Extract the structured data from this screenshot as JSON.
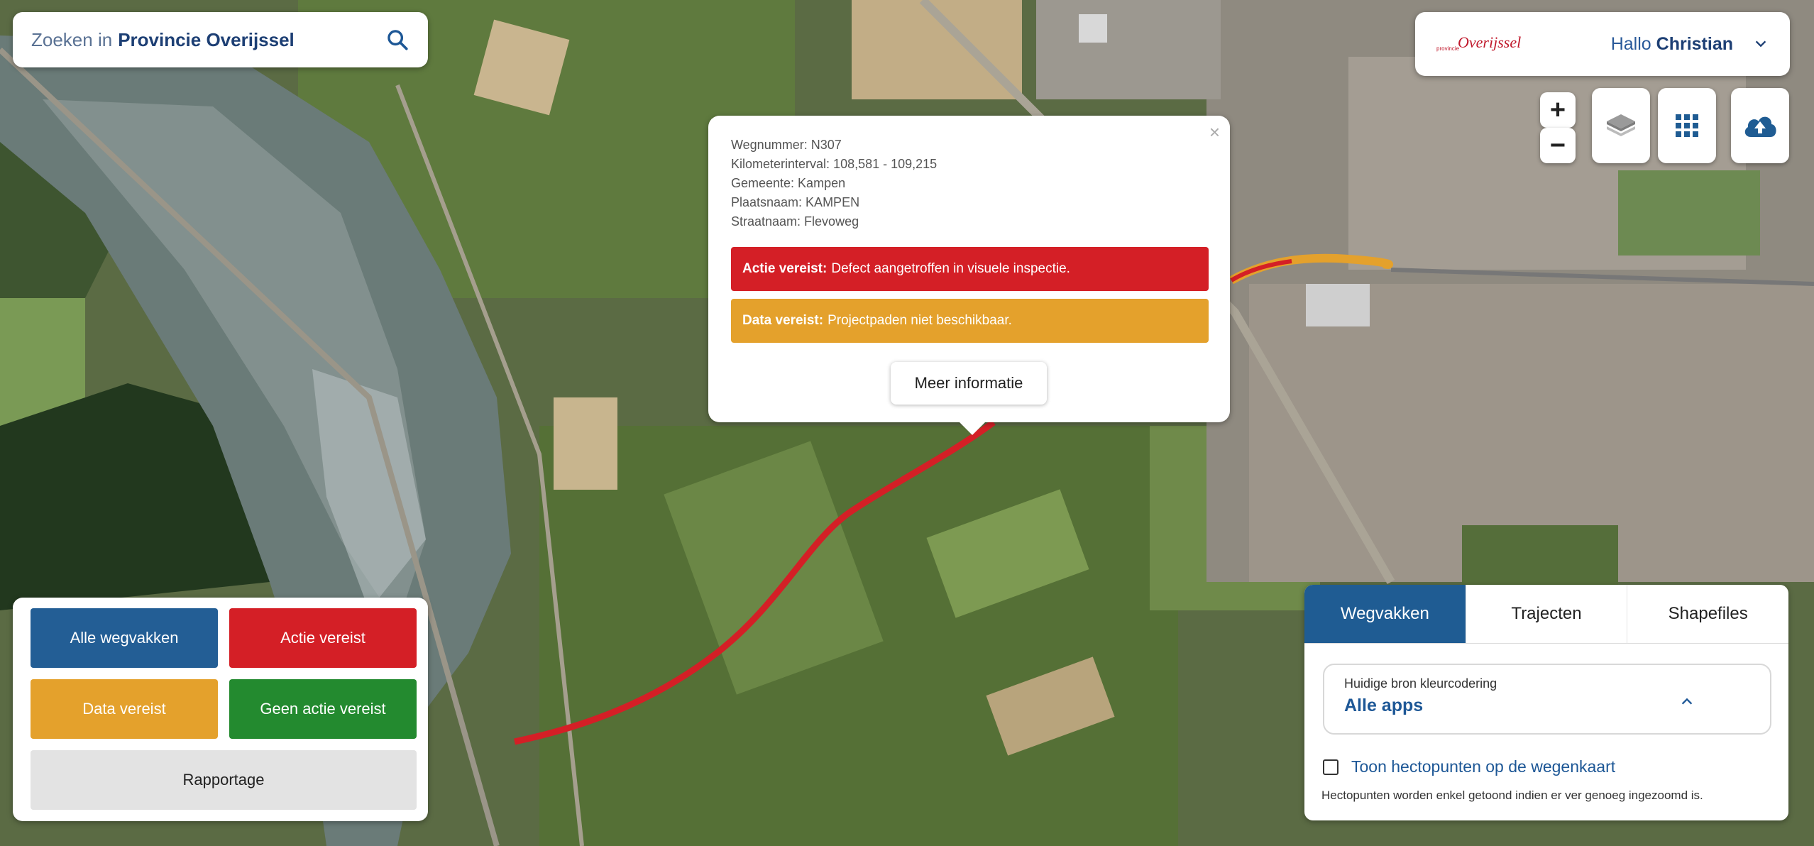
{
  "search": {
    "prefix": "Zoeken in",
    "scope": "Provincie Overijssel",
    "icon": "search-icon"
  },
  "user": {
    "logo_text": "Overijssel",
    "logo_small": "provincie",
    "greeting": "Hallo",
    "name": "Christian",
    "icon": "chevron-down-icon"
  },
  "controls": {
    "zoom_in": "+",
    "zoom_out": "−",
    "layers_icon": "layers-icon",
    "grid_icon": "apps-grid-icon",
    "upload_icon": "cloud-upload-icon"
  },
  "popup": {
    "close": "×",
    "lines": [
      "Wegnummer: N307",
      "Kilometerinterval: 108,581 - 109,215",
      "Gemeente: Kampen",
      "Plaatsnaam: KAMPEN",
      "Straatnaam: Flevoweg"
    ],
    "alert_red_title": "Actie vereist:",
    "alert_red_text": "Defect aangetroffen in visuele inspectie.",
    "alert_orange_title": "Data vereist:",
    "alert_orange_text": "Projectpaden niet beschikbaar.",
    "more_button": "Meer informatie"
  },
  "legend": {
    "all": "Alle wegvakken",
    "action": "Actie vereist",
    "data": "Data vereist",
    "none": "Geen actie vereist",
    "report": "Rapportage"
  },
  "panel": {
    "tabs": [
      "Wegvakken",
      "Trajecten",
      "Shapefiles"
    ],
    "source_label": "Huidige bron kleurcodering",
    "source_value": "Alle apps",
    "checkbox_label": "Toon hectopunten op de wegenkaart",
    "note": "Hectopunten worden enkel getoond indien er ver genoeg ingezoomd is."
  },
  "colors": {
    "blue": "#235e95",
    "red": "#d41f26",
    "orange": "#e4a12c",
    "green": "#238a2f",
    "grey": "#e3e3e3"
  }
}
